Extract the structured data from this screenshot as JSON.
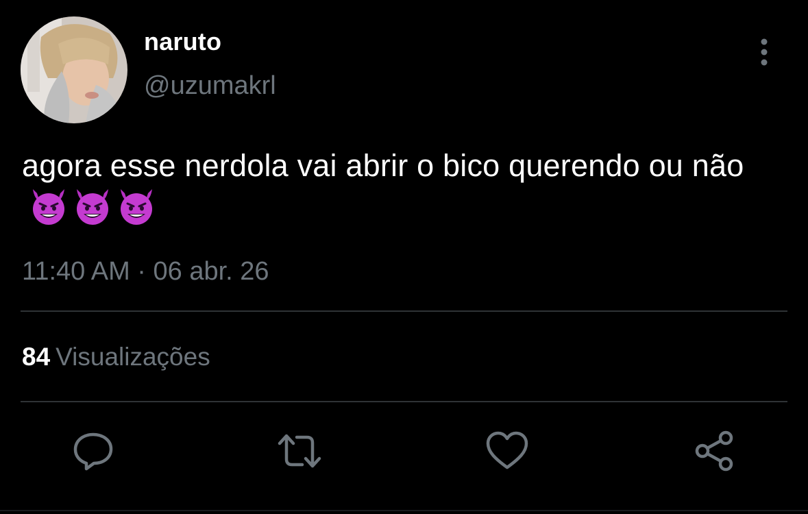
{
  "tweet": {
    "author": {
      "display_name": "naruto",
      "handle": "@uzumakrl"
    },
    "text": "agora esse nerdola vai abrir o bico querendo ou não",
    "emoji": [
      "smiling-devil-icon",
      "smiling-devil-icon",
      "smiling-devil-icon"
    ],
    "timestamp": "11:40 AM · 06 abr. 26",
    "views": {
      "count": "84",
      "label": "Visualizações"
    }
  },
  "actions": [
    "reply-icon",
    "retweet-icon",
    "like-icon",
    "share-icon"
  ],
  "colors": {
    "background": "#000000",
    "primary_text": "#ffffff",
    "secondary_text": "#6e767d",
    "divider": "#2f3336",
    "emoji": "#c43bd0"
  }
}
